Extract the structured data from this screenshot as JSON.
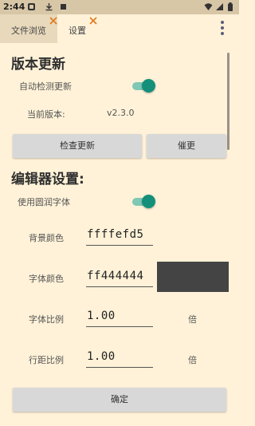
{
  "status_bar": {
    "time": "2:44",
    "icons": [
      "notification-icon",
      "download-icon",
      "square-icon",
      "wifi-icon",
      "signal-icon",
      "battery-icon"
    ]
  },
  "tabs": [
    {
      "label": "文件浏览",
      "active": false
    },
    {
      "label": "设置",
      "active": true
    }
  ],
  "version_section": {
    "title": "版本更新",
    "auto_check_label": "自动检测更新",
    "auto_check_on": true,
    "current_version_label": "当前版本:",
    "current_version": "v2.3.0",
    "check_button": "检查更新",
    "urge_button": "催更"
  },
  "editor_section": {
    "title": "编辑器设置:",
    "rounded_font_label": "使用圆润字体",
    "rounded_font_on": true,
    "bg_color_label": "背景颜色",
    "bg_color_value": "ffffefd5",
    "font_color_label": "字体颜色",
    "font_color_value": "ff444444",
    "font_scale_label": "字体比例",
    "font_scale_value": "1.00",
    "font_scale_unit": "倍",
    "line_spacing_label": "行距比例",
    "line_spacing_value": "1.00",
    "line_spacing_unit": "倍"
  },
  "confirm_button": "确定",
  "colors": {
    "background": "#fff2d8",
    "status_bar": "#d8c7a7",
    "accent": "#14907a",
    "tab_close": "#e07a1e",
    "swatch": "#444444"
  }
}
